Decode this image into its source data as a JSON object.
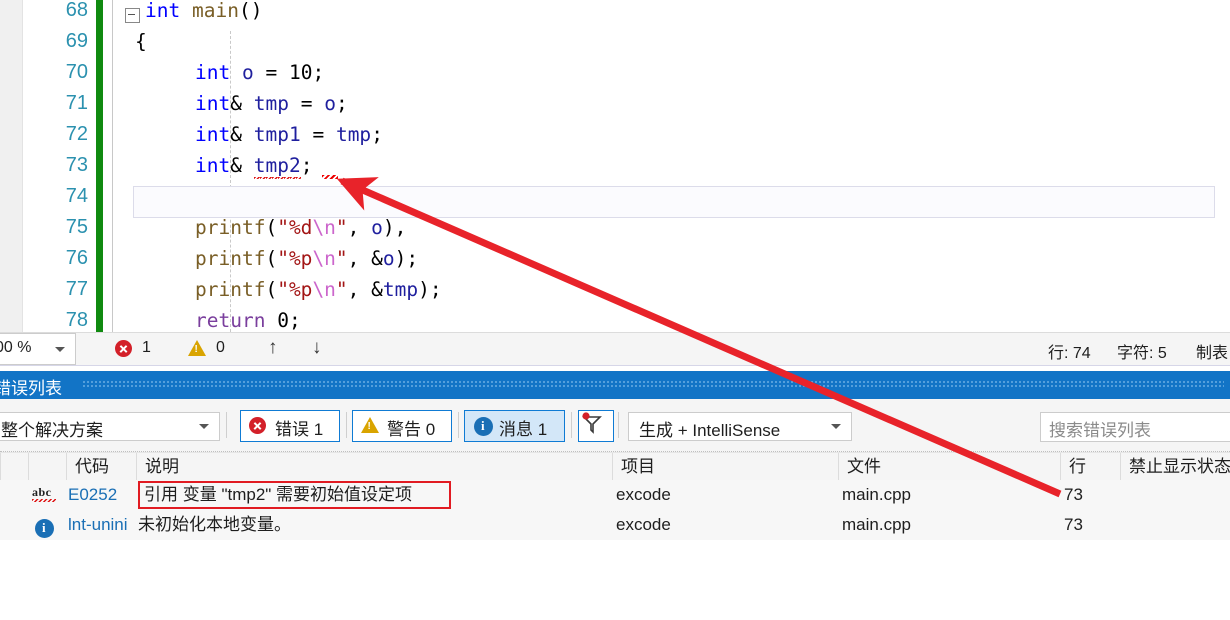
{
  "editor": {
    "lines": [
      {
        "num": "68",
        "text": "int main()"
      },
      {
        "num": "69",
        "text": "{"
      },
      {
        "num": "70",
        "text": "    int o = 10;"
      },
      {
        "num": "71",
        "text": "    int& tmp = o;"
      },
      {
        "num": "72",
        "text": "    int& tmp1 = tmp;"
      },
      {
        "num": "73",
        "text": "    int& tmp2;"
      },
      {
        "num": "74",
        "text": ""
      },
      {
        "num": "75",
        "text": "    printf(\"%d\\n\", o),"
      },
      {
        "num": "76",
        "text": "    printf(\"%p\\n\", &o);"
      },
      {
        "num": "77",
        "text": "    printf(\"%p\\n\", &tmp);"
      },
      {
        "num": "78",
        "text": "    return 0;"
      }
    ]
  },
  "statusbar": {
    "zoom": "00 %",
    "error_count": "1",
    "warning_count": "0",
    "prev_label": "↑",
    "next_label": "↓",
    "line_label": "行: 74",
    "char_label": "字符: 5",
    "tab_label": "制表"
  },
  "panel": {
    "title": "错误列表",
    "scope_filter": "整个解决方案",
    "errors_button": "错误 1",
    "warnings_button": "警告 0",
    "messages_button": "消息 1",
    "build_filter": "生成 + IntelliSense",
    "search_placeholder": "搜索错误列表",
    "columns": [
      "",
      "",
      "代码",
      "说明",
      "项目",
      "文件",
      "行",
      "禁止显示状态"
    ],
    "rows": [
      {
        "icon": "abc-squiggle-icon",
        "code": "E0252",
        "description": "引用 变量 \"tmp2\" 需要初始值设定项",
        "project": "excode",
        "file": "main.cpp",
        "line": "73",
        "suppression": ""
      },
      {
        "icon": "info-icon",
        "code": "lnt-unini",
        "description": "未初始化本地变量。",
        "project": "excode",
        "file": "main.cpp",
        "line": "73",
        "suppression": ""
      }
    ]
  },
  "colors": {
    "panel_title_bg": "#1274c6",
    "error_red": "#d32029",
    "warning_amber": "#d9a400",
    "info_blue": "#1a6fb5",
    "annotation_red": "#e8232a",
    "highlight_box_red": "#e11b22",
    "changebar_green": "#108a10",
    "linenumber_teal": "#2b91af"
  }
}
